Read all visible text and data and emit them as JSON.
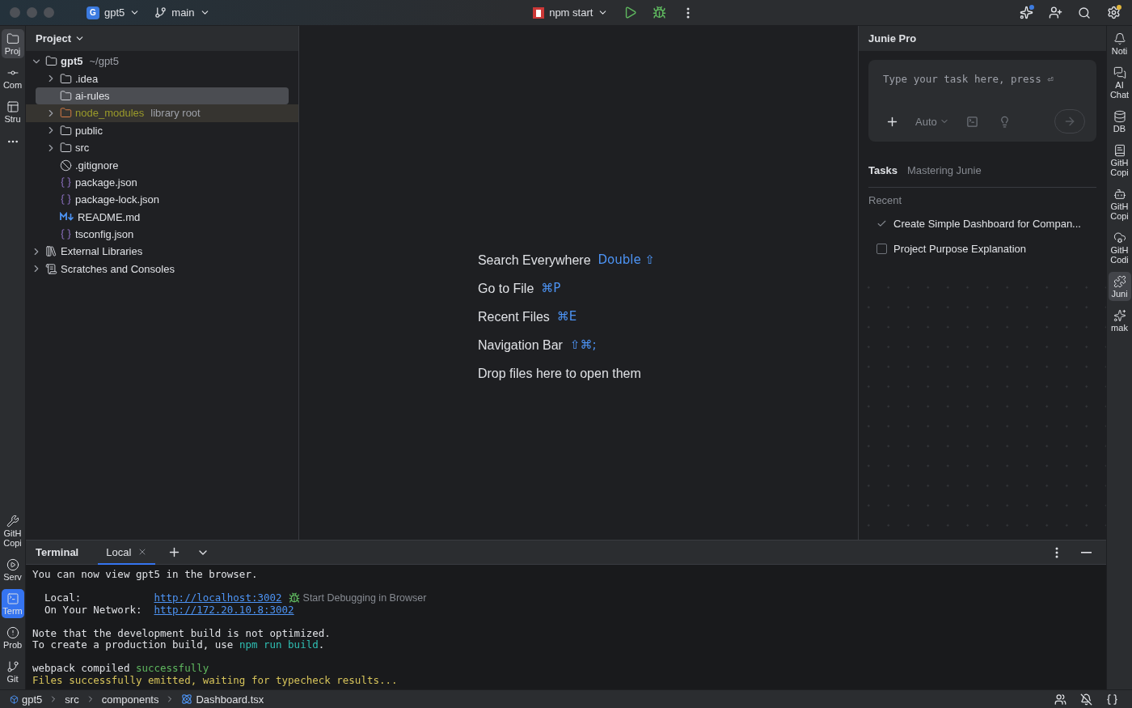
{
  "title_bar": {
    "project": {
      "badge": "G",
      "name": "gpt5"
    },
    "branch": "main",
    "run_config": "npm start"
  },
  "left_strip": {
    "top": [
      {
        "label": "Proj",
        "selected": true
      },
      {
        "label": "Com",
        "selected": false
      },
      {
        "label": "Stru",
        "selected": false
      }
    ],
    "bottom": [
      {
        "label": "GitH Copi",
        "selected": false
      },
      {
        "label": "Serv",
        "selected": false
      },
      {
        "label": "Term",
        "selected": true
      },
      {
        "label": "Prob",
        "selected": false
      },
      {
        "label": "Git",
        "selected": false
      }
    ]
  },
  "project_panel": {
    "title": "Project",
    "tree": [
      {
        "label": "gpt5",
        "hint": "~/gpt5",
        "kind": "project-root",
        "expanded": true,
        "selected": false,
        "children": [
          {
            "label": ".idea",
            "kind": "folder",
            "expanded": false,
            "selected": false
          },
          {
            "label": "ai-rules",
            "kind": "folder",
            "selected": true
          },
          {
            "label": "node_modules",
            "hint": "library root",
            "kind": "library-folder",
            "expanded": false,
            "selected": false
          },
          {
            "label": "public",
            "kind": "folder",
            "expanded": false,
            "selected": false
          },
          {
            "label": "src",
            "kind": "folder",
            "expanded": false,
            "selected": false
          },
          {
            "label": ".gitignore",
            "kind": "ignore-file",
            "selected": false
          },
          {
            "label": "package.json",
            "kind": "json-file",
            "selected": false
          },
          {
            "label": "package-lock.json",
            "kind": "json-file",
            "selected": false
          },
          {
            "label": "README.md",
            "kind": "markdown-file",
            "selected": false
          },
          {
            "label": "tsconfig.json",
            "kind": "json-file",
            "selected": false
          }
        ]
      },
      {
        "label": "External Libraries",
        "kind": "libraries",
        "expanded": false,
        "selected": false
      },
      {
        "label": "Scratches and Consoles",
        "kind": "scratches",
        "expanded": false,
        "selected": false
      }
    ]
  },
  "editor": {
    "hints": [
      {
        "label": "Search Everywhere",
        "shortcut": "Double ⇧"
      },
      {
        "label": "Go to File",
        "shortcut": "⌘P"
      },
      {
        "label": "Recent Files",
        "shortcut": "⌘E"
      },
      {
        "label": "Navigation Bar",
        "shortcut": "⇧⌘;"
      },
      {
        "label": "Drop files here to open them"
      }
    ]
  },
  "junie": {
    "title": "Junie Pro",
    "input": {
      "placeholder": "Type your task here, press ⏎"
    },
    "mode": "Auto",
    "tabs": [
      {
        "label": "Tasks",
        "selected": true
      },
      {
        "label": "Mastering Junie",
        "selected": false
      }
    ],
    "section": "Recent",
    "tasks": [
      {
        "title": "Create Simple Dashboard for Compan...",
        "done": true
      },
      {
        "title": "Project Purpose Explanation",
        "done": false
      }
    ]
  },
  "right_strip": [
    {
      "label": "Noti",
      "selected": false
    },
    {
      "label": "AI Chat",
      "selected": false
    },
    {
      "label": "DB",
      "selected": false
    },
    {
      "label": "GitH Copi",
      "selected": false
    },
    {
      "label": "GitH Copi",
      "selected": false
    },
    {
      "label": "GitH Codi",
      "selected": false
    },
    {
      "label": "Juni",
      "selected": true
    },
    {
      "label": "mak",
      "selected": false
    }
  ],
  "terminal": {
    "title": "Terminal",
    "tabs": [
      {
        "label": "Local",
        "selected": true
      }
    ],
    "blocks": [
      [
        [
          {
            "text": "You can now view gpt5 in the browser.",
            "kind": "plain"
          }
        ]
      ],
      [
        [
          {
            "text": "Local:",
            "kind": "label"
          },
          {
            "text": "http://localhost:3002",
            "kind": "link"
          },
          {
            "text": "Start Debugging in Browser",
            "kind": "action"
          }
        ],
        [
          {
            "text": "On Your Network:",
            "kind": "label"
          },
          {
            "text": "http://172.20.10.8:3002",
            "kind": "link"
          }
        ]
      ],
      [
        [
          {
            "text": "Note that the development build is not optimized.",
            "kind": "plain"
          }
        ],
        [
          {
            "text": "To create a production build, use ",
            "kind": "plain"
          },
          {
            "text": "npm run build",
            "kind": "command"
          },
          {
            "text": ".",
            "kind": "plain"
          }
        ]
      ],
      [
        [
          {
            "text": "webpack compiled ",
            "kind": "plain"
          },
          {
            "text": "successfully",
            "kind": "success"
          }
        ],
        [
          {
            "text": "Files successfully emitted, waiting for typecheck results...",
            "kind": "warning"
          }
        ]
      ]
    ]
  },
  "status_bar": {
    "breadcrumbs": [
      {
        "label": "gpt5",
        "kind": "module"
      },
      {
        "label": "src",
        "kind": "folder"
      },
      {
        "label": "components",
        "kind": "folder"
      },
      {
        "label": "Dashboard.tsx",
        "kind": "react-file"
      }
    ]
  }
}
